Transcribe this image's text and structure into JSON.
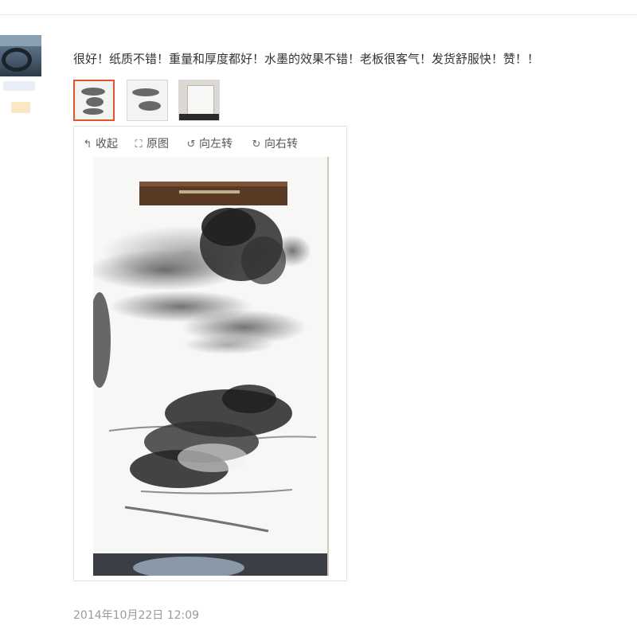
{
  "review": {
    "text": "很好！纸质不错！重量和厚度都好！水墨的效果不错！老板很客气！发货舒服快！赞！！",
    "timestamp": "2014年10月22日 12:09"
  },
  "viewer": {
    "toolbar": {
      "collapse_icon": "↰",
      "collapse_label": "收起",
      "original_icon": "⛶",
      "original_label": "原图",
      "rotate_left_icon": "↺",
      "rotate_left_label": "向左转",
      "rotate_right_icon": "↻",
      "rotate_right_label": "向右转"
    },
    "selected_thumbnail": 1
  },
  "thumbnails": [
    {
      "name": "ink-landscape-thumb-1",
      "selected": true
    },
    {
      "name": "ink-landscape-thumb-2",
      "selected": false
    },
    {
      "name": "paper-stack-thumb-3",
      "selected": false
    }
  ],
  "colors": {
    "selected_border": "#e4542c",
    "timestamp_gray": "#9a9a9a",
    "text": "#333333"
  }
}
